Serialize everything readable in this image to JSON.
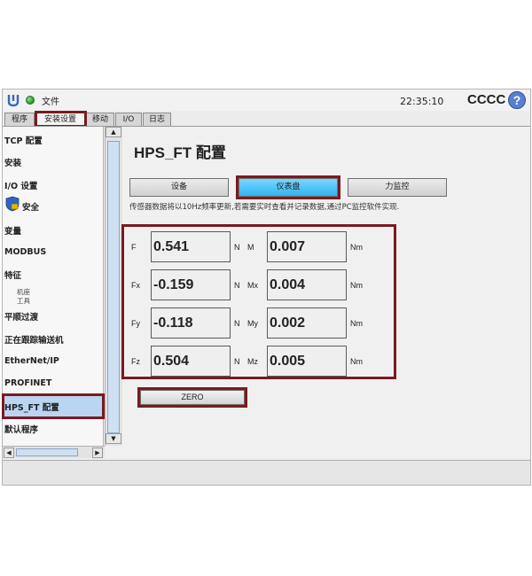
{
  "topbar": {
    "file_menu": "文件",
    "clock": "22:35:10",
    "robot_name": "CCCC",
    "help_icon": "?"
  },
  "tabs": [
    {
      "label": "程序"
    },
    {
      "label": "安装设置"
    },
    {
      "label": "移动"
    },
    {
      "label": "I/O"
    },
    {
      "label": "日志"
    }
  ],
  "sidebar": {
    "items": [
      {
        "label": "TCP 配置"
      },
      {
        "label": "安装"
      },
      {
        "label": "I/O 设置"
      },
      {
        "label": "安全"
      },
      {
        "label": "变量"
      },
      {
        "label": "MODBUS"
      },
      {
        "label": "特征"
      },
      {
        "label": "平顺过渡"
      },
      {
        "label": "正在跟踪输送机"
      },
      {
        "label": "EtherNet/IP"
      },
      {
        "label": "PROFINET"
      },
      {
        "label": "HPS_FT 配置"
      },
      {
        "label": "默认程序"
      }
    ],
    "sub_items": [
      {
        "label": "机座"
      },
      {
        "label": "工具"
      }
    ],
    "scroll_up": "▲",
    "scroll_down": "▼",
    "scroll_left": "◀",
    "scroll_right": "▶"
  },
  "main": {
    "title": "HPS_FT 配置",
    "subtabs": [
      {
        "label": "设备"
      },
      {
        "label": "仪表盘"
      },
      {
        "label": "力监控"
      }
    ],
    "info": "传感器数据将以10Hz频率更新,若需要实时查看并记录数据,通过PC监控软件实现.",
    "readings": [
      {
        "label": "F",
        "value": "0.541",
        "unit": "N",
        "mlabel": "M",
        "mvalue": "0.007",
        "munit": "Nm"
      },
      {
        "label": "Fx",
        "value": "-0.159",
        "unit": "N",
        "mlabel": "Mx",
        "mvalue": "0.004",
        "munit": "Nm"
      },
      {
        "label": "Fy",
        "value": "-0.118",
        "unit": "N",
        "mlabel": "My",
        "mvalue": "0.002",
        "munit": "Nm"
      },
      {
        "label": "Fz",
        "value": "0.504",
        "unit": "N",
        "mlabel": "Mz",
        "mvalue": "0.005",
        "munit": "Nm"
      }
    ],
    "zero_button": "ZERO"
  },
  "colors": {
    "highlight": "#7a1a1f",
    "active_subtab": "#2eb3f2",
    "selected_nav": "#b9d5f2",
    "help_button": "#5a7fd0"
  },
  "icons": [
    "ur-logo-icon",
    "run-status-icon",
    "help-icon",
    "shield-icon"
  ]
}
